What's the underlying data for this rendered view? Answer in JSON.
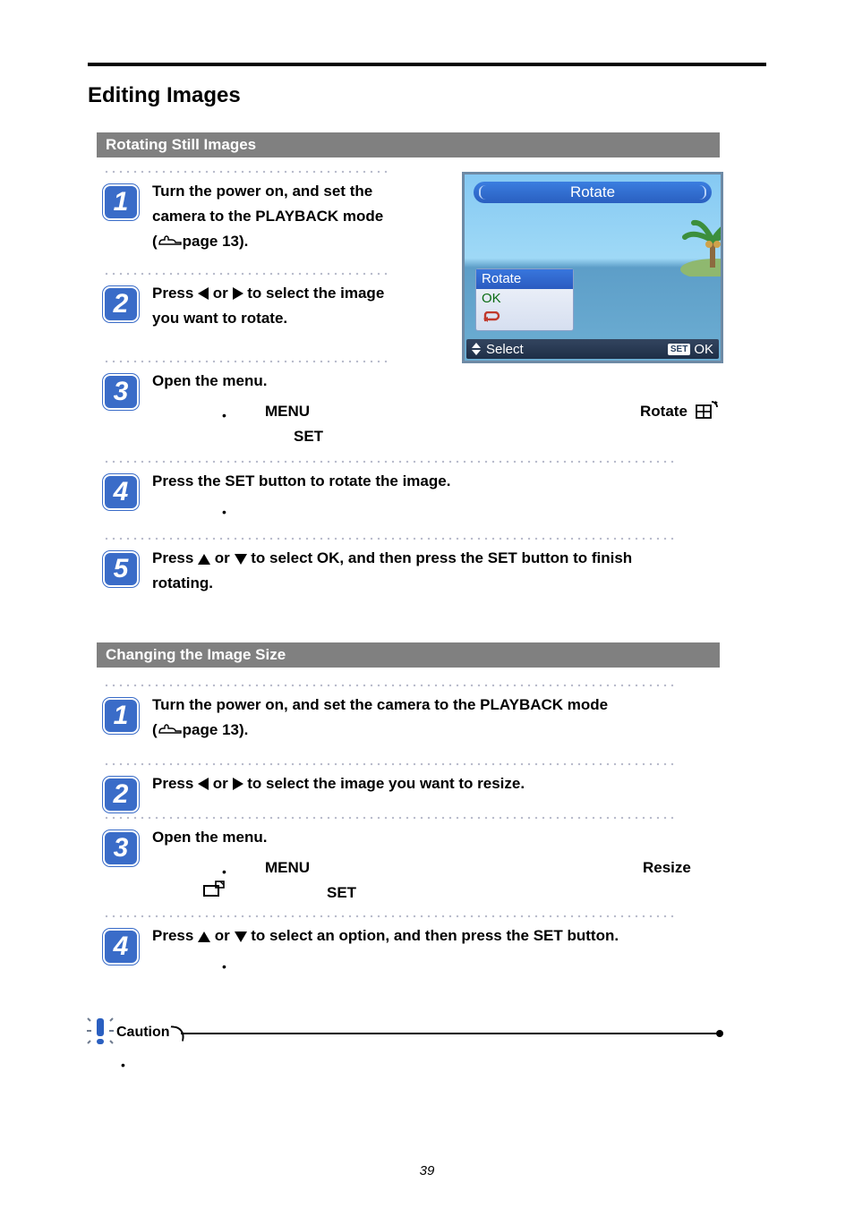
{
  "page": {
    "title": "Editing Images",
    "number": "39"
  },
  "section1": {
    "header": "Rotating Still Images",
    "steps": {
      "s1": {
        "num": "1",
        "a": "Turn the power on, and set the",
        "b": "camera to the PLAYBACK mode",
        "c": "page 13)."
      },
      "s2": {
        "num": "2",
        "a_pre": "Press ",
        "a_mid": " or ",
        "a_post": " to select the image",
        "b": "you want to rotate."
      },
      "s3": {
        "num": "3",
        "a": "Open the menu.",
        "menu_word": "MENU",
        "rotate_word": "Rotate",
        "set_word": "SET"
      },
      "s4": {
        "num": "4",
        "a": "Press the SET button to rotate the image."
      },
      "s5": {
        "num": "5",
        "a_pre": "Press ",
        "a_mid": " or ",
        "a_post": " to select OK, and then press the SET button to finish",
        "b": "rotating."
      }
    },
    "screen": {
      "title": "Rotate",
      "items": {
        "rotate": "Rotate",
        "ok": "OK"
      },
      "footer": {
        "select": "Select",
        "set": "SET",
        "ok": "OK"
      }
    }
  },
  "section2": {
    "header": "Changing the Image Size",
    "steps": {
      "s1": {
        "num": "1",
        "a": "Turn the power on, and set the camera to the PLAYBACK mode",
        "b": "page 13)."
      },
      "s2": {
        "num": "2",
        "a_pre": "Press ",
        "a_mid": " or ",
        "a_post": " to select the image you want to resize."
      },
      "s3": {
        "num": "3",
        "a": "Open the menu.",
        "menu_word": "MENU",
        "resize_word": "Resize",
        "set_word": "SET"
      },
      "s4": {
        "num": "4",
        "a_pre": "Press ",
        "a_mid": " or ",
        "a_post": " to select an option, and then press the SET button."
      }
    }
  },
  "caution": {
    "label": "Caution"
  }
}
